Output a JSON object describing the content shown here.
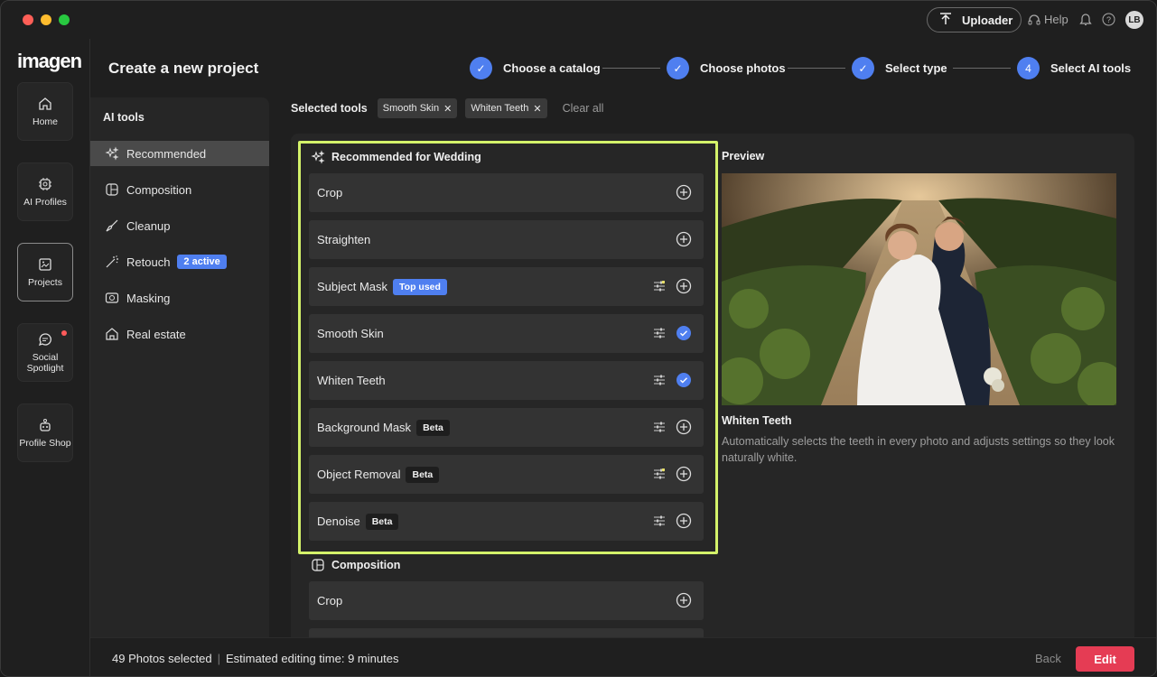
{
  "window": {
    "traffic_lights": [
      "close",
      "minimize",
      "zoom"
    ]
  },
  "topbar": {
    "uploader_label": "Uploader",
    "help_label": "Help",
    "avatar_initials": "LB"
  },
  "rail": {
    "logo": "imagen",
    "items": [
      {
        "label": "Home",
        "icon": "home-icon"
      },
      {
        "label": "AI Profiles",
        "icon": "ai-chip-icon"
      },
      {
        "label": "Projects",
        "icon": "projects-icon",
        "active": true
      },
      {
        "label": "Social Spotlight",
        "icon": "chat-icon",
        "notification": true
      },
      {
        "label": "Profile Shop",
        "icon": "shop-icon"
      }
    ]
  },
  "page": {
    "title": "Create a new project"
  },
  "stepper": {
    "steps": [
      {
        "label": "Choose a catalog",
        "state": "done"
      },
      {
        "label": "Choose photos",
        "state": "done"
      },
      {
        "label": "Select type",
        "state": "done"
      },
      {
        "label": "Select AI tools",
        "state": "current",
        "number": "4"
      }
    ]
  },
  "ai_tools": {
    "heading": "AI tools",
    "categories": [
      {
        "label": "Recommended",
        "icon": "sparkle-icon",
        "selected": true
      },
      {
        "label": "Composition",
        "icon": "composition-icon"
      },
      {
        "label": "Cleanup",
        "icon": "brush-icon"
      },
      {
        "label": "Retouch",
        "icon": "wand-icon",
        "badge": "2 active"
      },
      {
        "label": "Masking",
        "icon": "mask-icon"
      },
      {
        "label": "Real estate",
        "icon": "house-icon"
      }
    ]
  },
  "selected_tools": {
    "label": "Selected tools",
    "chips": [
      "Smooth Skin",
      "Whiten Teeth"
    ],
    "clear_label": "Clear all"
  },
  "recommended_section": {
    "heading": "Recommended for Wedding",
    "rows": [
      {
        "label": "Crop",
        "tag": "",
        "settings": false,
        "added": false
      },
      {
        "label": "Straighten",
        "tag": "",
        "settings": false,
        "added": false
      },
      {
        "label": "Subject Mask",
        "tag": "Top used",
        "settings": true,
        "settings_dot": true,
        "added": false
      },
      {
        "label": "Smooth Skin",
        "tag": "",
        "settings": true,
        "added": true
      },
      {
        "label": "Whiten Teeth",
        "tag": "",
        "settings": true,
        "added": true
      },
      {
        "label": "Background Mask",
        "tag": "Beta",
        "settings": true,
        "added": false
      },
      {
        "label": "Object Removal",
        "tag": "Beta",
        "settings": true,
        "settings_dot": true,
        "added": false
      },
      {
        "label": "Denoise",
        "tag": "Beta",
        "settings": true,
        "added": false
      }
    ]
  },
  "composition_section": {
    "heading": "Composition",
    "rows": [
      {
        "label": "Crop",
        "added": false
      }
    ]
  },
  "preview": {
    "label": "Preview",
    "title": "Whiten Teeth",
    "description": "Automatically selects the teeth in every photo and adjusts settings so they look naturally white."
  },
  "footer": {
    "photos_selected": "49 Photos selected",
    "estimate": "Estimated editing time: 9 minutes",
    "back_label": "Back",
    "edit_label": "Edit"
  },
  "colors": {
    "accent": "#4f7ff0",
    "highlight": "#d4f26a",
    "primary_button": "#e53c54"
  }
}
